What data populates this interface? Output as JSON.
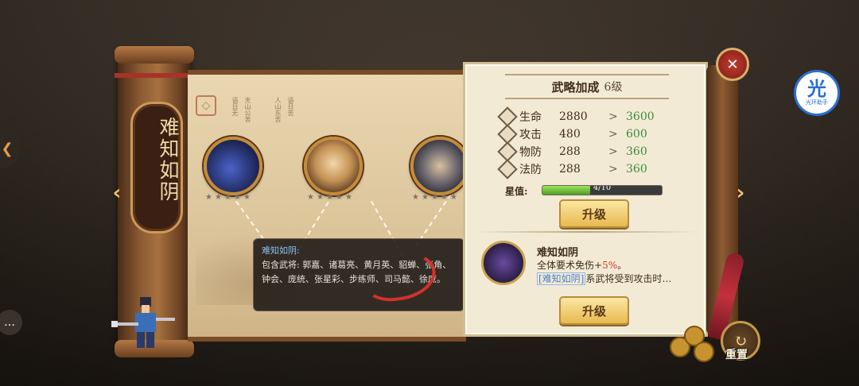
{
  "scroll": {
    "title": "难知如阴"
  },
  "map": {
    "poem_columns": [
      "语日无",
      "天山公苦",
      "人山东苦",
      "语日苦"
    ],
    "portraits": [
      {
        "name": "portrait-1",
        "stars": 5,
        "color": "#3b4fa0"
      },
      {
        "name": "portrait-2",
        "stars": 5,
        "color": "#d6a86a"
      },
      {
        "name": "portrait-3",
        "stars": 5,
        "color": "#4a4a5a"
      }
    ]
  },
  "tooltip": {
    "title": "难知如阴:",
    "body": "包含武将: 郭嘉、诸葛亮、黄月英、貂蝉、张角、钟会、庞统、张星彩、步练师、司马懿、徐庶。"
  },
  "panel": {
    "title": "武略加成",
    "level": "6级",
    "stats": [
      {
        "name": "生命",
        "old": "2880",
        "gt": ">",
        "new": "3600"
      },
      {
        "name": "攻击",
        "old": "480",
        "gt": ">",
        "new": "600"
      },
      {
        "name": "物防",
        "old": "288",
        "gt": ">",
        "new": "360"
      },
      {
        "name": "法防",
        "old": "288",
        "gt": ">",
        "new": "360"
      }
    ],
    "star_value_label": "星值:",
    "star_value_text": "4/10",
    "star_value_progress": 0.4,
    "upgrade_label": "升级",
    "skill": {
      "name": "难知如阴",
      "desc_prefix": "全体要术免伤+",
      "desc_highlight": "5%",
      "desc_suffix": "。",
      "line2_tag": "[难知如阴]",
      "line2_text": "系武将受到攻击时…"
    },
    "upgrade2_label": "升级"
  },
  "controls": {
    "close_glyph": "✕",
    "prev_glyph": "‹",
    "next_glyph": "›",
    "reset_label": "重置",
    "helper_glyph": "光",
    "helper_label": "光环助手",
    "chat_glyph": "…"
  },
  "colors": {
    "accent_green": "#3a8a3a",
    "highlight_red": "#d23a2a",
    "tag_blue": "#4a82c8"
  }
}
